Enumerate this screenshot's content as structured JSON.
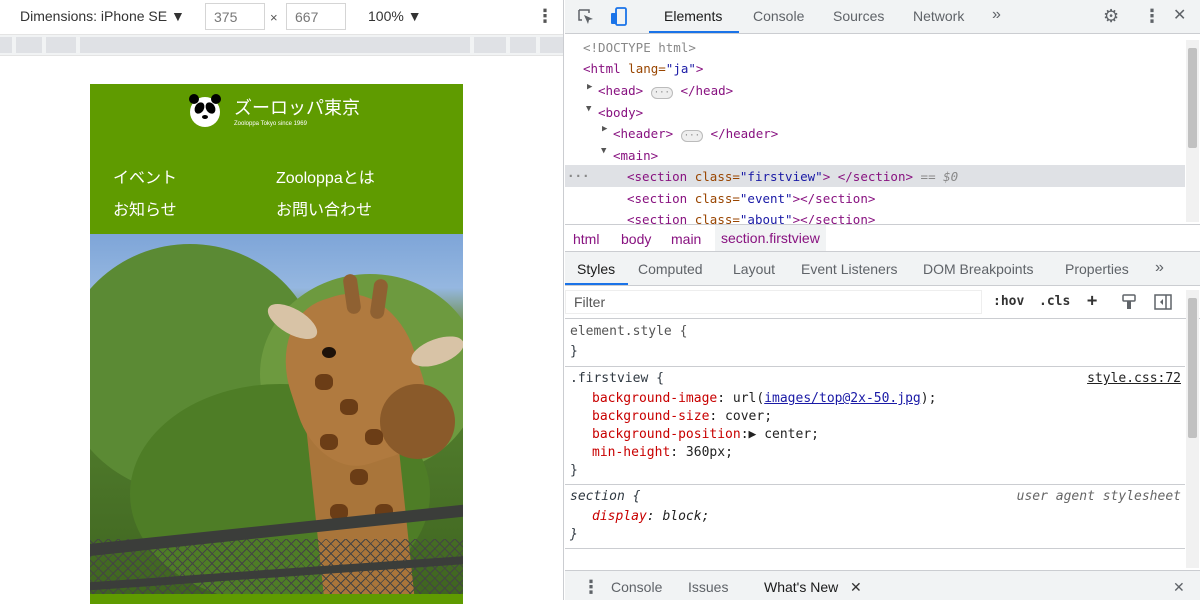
{
  "device_toolbar": {
    "device": "Dimensions: iPhone SE ▼",
    "width": "375",
    "height": "667",
    "times": "×",
    "zoom": "100% ▼",
    "more": "⋮"
  },
  "site": {
    "logo_name": "ズーロッパ東京",
    "logo_sub": "Zooloppa Tokyo since 1969",
    "nav": [
      "イベント",
      "Zooloppaとは",
      "お知らせ",
      "お問い合わせ"
    ]
  },
  "devtools": {
    "tabs": [
      "Elements",
      "Console",
      "Sources",
      "Network"
    ],
    "more_tabs": "»",
    "close": "✕",
    "menu": "⋮",
    "dom": {
      "doctype": "<!DOCTYPE html>",
      "html_open_tag": "<html",
      "html_attr": " lang=",
      "html_val": "\"ja\"",
      "html_close": ">",
      "head_open": "<head>",
      "head_close": "</head>",
      "body_open": "<body>",
      "header_open": "<header>",
      "header_close": "</header>",
      "main_open": "<main>",
      "sec1_open": "<section",
      "sec1_attr": " class=",
      "sec1_val": "\"firstview\"",
      "sec1_close": "> </section>",
      "sec1_sel": " == $0",
      "sec2_open": "<section",
      "sec2_attr": " class=",
      "sec2_val": "\"event\"",
      "sec2_close": "></section>",
      "sec3_open": "<section",
      "sec3_attr": " class=",
      "sec3_val": "\"about\"",
      "sec3_close": "></section>",
      "ellipsis": "···",
      "gutter_dots": "···"
    },
    "breadcrumbs": [
      "html",
      "body",
      "main",
      "section.firstview"
    ],
    "subtabs": [
      "Styles",
      "Computed",
      "Layout",
      "Event Listeners",
      "DOM Breakpoints",
      "Properties"
    ],
    "subtabs_more": "»",
    "filter_placeholder": "Filter",
    "filter_tools": [
      ":hov",
      ".cls",
      "+"
    ],
    "styles": {
      "element_style_open": "element.style {",
      "element_style_close": "}",
      "firstview_selector": ".firstview {",
      "firstview_source": "style.css:72",
      "bg_image_prop": "background-image",
      "bg_image_pre": ": url(",
      "bg_image_url": "images/top@2x-50.jpg",
      "bg_image_post": ");",
      "bg_size_prop": "background-size",
      "bg_size_val": ": cover;",
      "bg_pos_prop": "background-position",
      "bg_pos_val": ":▶ center;",
      "min_h_prop": "min-height",
      "min_h_val": ": 360px;",
      "firstview_close": "}",
      "section_selector": "section {",
      "section_source": "user agent stylesheet",
      "display_prop": "display",
      "display_val": ": block;",
      "section_close": "}"
    },
    "drawer": {
      "menu": "⋮",
      "tabs": [
        "Console",
        "Issues",
        "What's New"
      ],
      "tab_close": "✕",
      "close": "✕"
    }
  }
}
